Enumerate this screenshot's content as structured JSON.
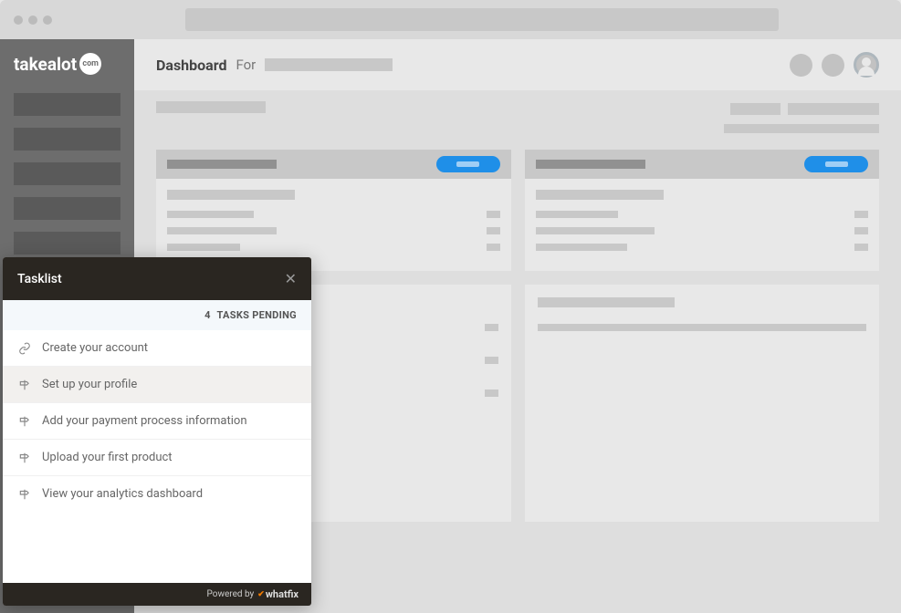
{
  "logo": {
    "brand": "takealot",
    "ext": "com"
  },
  "header": {
    "title": "Dashboard",
    "for": "For"
  },
  "tasklist": {
    "title": "Tasklist",
    "pending_count": "4",
    "pending_label": "TASKS PENDING",
    "items": [
      {
        "label": "Create your account",
        "icon": "link"
      },
      {
        "label": "Set up your profile",
        "icon": "signpost",
        "selected": true
      },
      {
        "label": "Add your payment process information",
        "icon": "signpost"
      },
      {
        "label": "Upload your first product",
        "icon": "signpost"
      },
      {
        "label": "View your analytics dashboard",
        "icon": "signpost"
      }
    ],
    "footer": {
      "powered_by": "Powered by",
      "brand": "whatfix"
    }
  }
}
